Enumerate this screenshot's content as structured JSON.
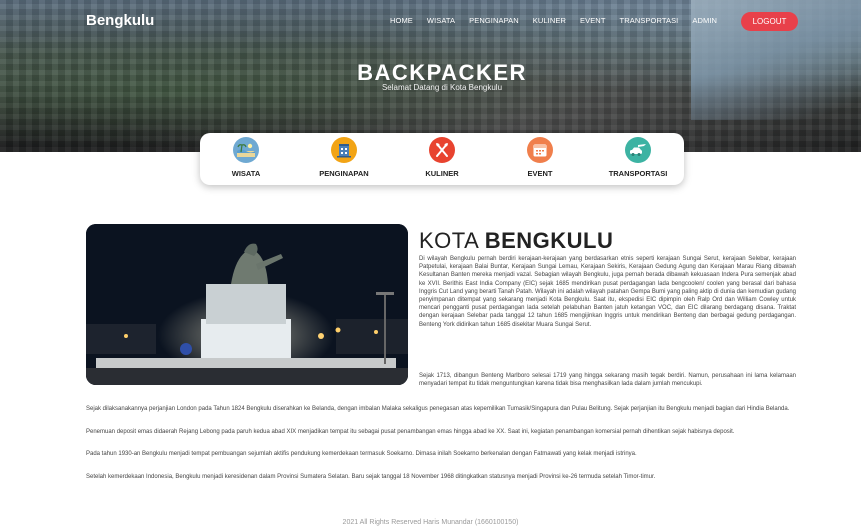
{
  "header": {
    "brand": "Bengkulu",
    "nav": [
      "HOME",
      "WISATA",
      "PENGINAPAN",
      "KULINER",
      "EVENT",
      "TRANSPORTASI",
      "ADMIN"
    ],
    "logout": "LOGOUT"
  },
  "hero": {
    "title": "BACKPACKER",
    "subtitle": "Selamat Datang di Kota Bengkulu"
  },
  "categories": [
    {
      "label": "WISATA",
      "icon": "beach-icon",
      "color": "#6fa9d2"
    },
    {
      "label": "PENGINAPAN",
      "icon": "hotel-icon",
      "color": "#f2a415"
    },
    {
      "label": "KULINER",
      "icon": "utensils-icon",
      "color": "#e8432f"
    },
    {
      "label": "EVENT",
      "icon": "calendar-icon",
      "color": "#f07f4c"
    },
    {
      "label": "TRANSPORTASI",
      "icon": "car-plane-icon",
      "color": "#3db3a3"
    }
  ],
  "main": {
    "heading_light": "KOTA",
    "heading_bold": "BENGKULU",
    "paragraphs": [
      "Di wilayah Bengkulu pernah berdiri kerajaan-kerajaan yang berdasarkan etnis seperti kerajaan Sungai Serut, kerajaan Selebar, kerajaan Patpetulai, kerajaan Balai Buntar, Kerajaan Sungai Lemau, Kerajaan Sekiris, Kerajaan Gedung Agung dan Kerajaan Marau Riang dibawah Kesultanan Banten mereka menjadi vazal. Sebagian wilayah Bengkulu, juga pernah berada dibawah kekuasaan Indera Pura semenjak abad ke XVII. Berithis East India Company (EIC) sejak 1685 mendirikan pusat perdagangan lada bengcoolen/ coolen yang berasal dari bahasa Inggris Cut Land yang berarti Tanah Patah. Wilayah ini adalah wilayah patahan Gempa Bumi yang paling aktip di dunia dan kemudian gudang penyimpanan ditempat yang sekarang menjadi Kota Bengkulu. Saat itu, ekspedisi EIC dipimpin oleh Ralp Ord dan William Cowley untuk mencari pengganti pusat perdagangan lada setelah pelabuhan Banten jatuh ketangan VOC, dan EIC dilarang berdagang disana. Traktat dengan kerajaan Selebar pada tanggal 12 tahun 1685 mengijinkan Inggris untuk mendirikan Benteng dan berbagai gedung perdagangan. Benteng York didirikan tahun 1685 disekitar Muara Sungai Serut.",
      "Sejak 1713, dibangun Benteng Marlboro selesai 1719 yang hingga sekarang masih tegak berdiri. Namun, perusahaan ini lama kelamaan menyadari tempat itu tidak menguntungkan karena tidak bisa menghasilkan lada dalam jumlah mencukupi.",
      "Sejak dilaksanakannya perjanjian London pada Tahun 1824 Bengkulu diserahkan ke Belanda, dengan imbalan Malaka sekaligus penegasan atas kepemilikan Tumasik/Singapura dan Pulau Belitung. Sejak perjanjian itu Bengkulu menjadi bagian dari Hindia Belanda.",
      "Penemuan deposit emas didaerah Rejang Lebong pada paruh kedua abad XIX menjadikan tempat itu sebagai pusat penambangan emas hingga abad ke XX. Saat ini, kegiatan penambangan komersial pernah dihentikan sejak habisnya deposit.",
      "Pada tahun 1930-an Bengkulu menjadi tempat pembuangan sejumlah aktifis pendukung kemerdekaan termasuk Soekarno. Dimasa inilah Soekarno berkenalan dengan Fatmawati yang kelak menjadi istrinya.",
      "Setelah kemerdekaan Indonesia, Bengkulu menjadi keresidenan dalam Provinsi Sumatera Selatan. Baru sejak tanggal 18 November 1968 ditingkatkan statusnya menjadi Provinsi ke-26 termuda setelah Timor-timur."
    ]
  },
  "footer": {
    "text": "2021 All Rights Reserved Haris Munandar (1660100150)"
  }
}
